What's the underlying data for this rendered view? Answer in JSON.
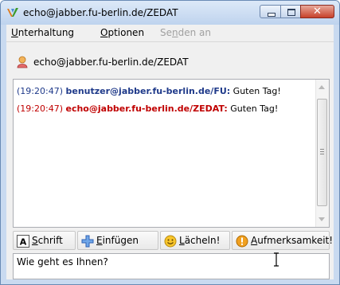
{
  "window": {
    "title": "echo@jabber.fu-berlin.de/ZEDAT",
    "app_icon": "jabber-v-icon",
    "controls": [
      "minimize-icon",
      "maximize-icon",
      "close-icon"
    ]
  },
  "menu": {
    "items": [
      {
        "pre": "",
        "acc": "U",
        "post": "nterhaltung",
        "disabled": false
      },
      {
        "pre": "",
        "acc": "O",
        "post": "ptionen",
        "disabled": false
      },
      {
        "pre": "Se",
        "acc": "n",
        "post": "den an",
        "disabled": true
      }
    ]
  },
  "contact": {
    "icon": "user-avatar-icon",
    "name": "echo@jabber.fu-berlin.de/ZEDAT"
  },
  "chat": {
    "messages": [
      {
        "time": "(19:20:47)",
        "nick": "benutzer@jabber.fu-berlin.de/FU:",
        "text": "Guten Tag!",
        "color": "#1f3a8a"
      },
      {
        "time": "(19:20:47)",
        "nick": "echo@jabber.fu-berlin.de/ZEDAT:",
        "text": "Guten Tag!",
        "color": "#c00000"
      }
    ]
  },
  "toolbar": {
    "font": {
      "pre": "",
      "acc": "S",
      "post": "chrift",
      "icon": "font-a-icon"
    },
    "insert": {
      "pre": "",
      "acc": "E",
      "post": "infügen",
      "icon": "insert-plus-icon"
    },
    "smile": {
      "pre": "",
      "acc": "L",
      "post": "ächeln!",
      "icon": "smiley-icon"
    },
    "attention": {
      "pre": "",
      "acc": "A",
      "post": "ufmerksamkeit!",
      "icon": "attention-icon"
    }
  },
  "input": {
    "value": "Wie geht es Ihnen?"
  }
}
